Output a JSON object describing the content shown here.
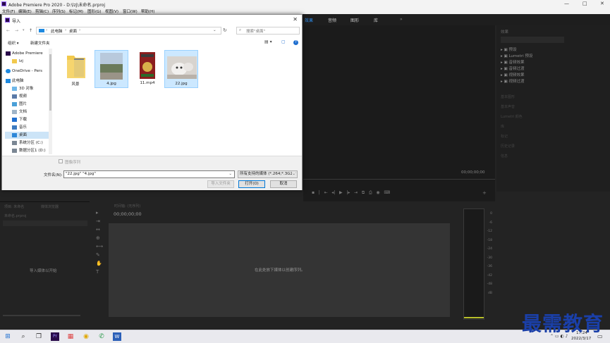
{
  "app": {
    "title": "Adobe Premiere Pro 2020 - D:\\lzj\\未命名.prproj",
    "window_controls": [
      "—",
      "□",
      "✕"
    ],
    "menu": [
      "文件(F)",
      "编辑(E)",
      "剪辑(C)",
      "序列(S)",
      "标记(M)",
      "图形(G)",
      "视图(V)",
      "窗口(W)",
      "帮助(H)"
    ],
    "workspaces": [
      "效果",
      "音频",
      "图形",
      "库"
    ],
    "workspace_active": "效果"
  },
  "effects_panel": {
    "title": "效果",
    "items": [
      "预设",
      "Lumetri 预设",
      "音频效果",
      "音频过渡",
      "视频效果",
      "视频过渡"
    ],
    "sections": [
      "基本图形",
      "基本声音",
      "Lumetri 颜色",
      "库",
      "标记",
      "历史记录",
      "信息"
    ]
  },
  "program_monitor": {
    "timecode": "00;00;00;00"
  },
  "dialog": {
    "title": "导入",
    "breadcrumb": [
      "此电脑",
      "桌面"
    ],
    "search_placeholder": "搜索\"桌面\"",
    "toolbar": {
      "organize": "组织 ▾",
      "new_folder": "新建文件夹"
    },
    "sidebar": [
      {
        "label": "Adobe Premiere",
        "icon": "premiere-icon"
      },
      {
        "label": "lzj",
        "icon": "folder-icon"
      },
      {
        "label": "OneDrive - Pers",
        "icon": "cloud-icon"
      },
      {
        "label": "此电脑",
        "icon": "computer-icon"
      },
      {
        "label": "3D 对象",
        "icon": "cube-icon"
      },
      {
        "label": "视频",
        "icon": "video-icon"
      },
      {
        "label": "图片",
        "icon": "picture-icon"
      },
      {
        "label": "文档",
        "icon": "document-icon"
      },
      {
        "label": "下载",
        "icon": "download-icon"
      },
      {
        "label": "音乐",
        "icon": "music-icon"
      },
      {
        "label": "桌面",
        "icon": "desktop-icon",
        "selected": true
      },
      {
        "label": "系统分区 (C:)",
        "icon": "drive-icon"
      },
      {
        "label": "数据分区1 (D:)",
        "icon": "drive-icon"
      }
    ],
    "files": [
      {
        "name": "风景",
        "type": "folder"
      },
      {
        "name": "4.jpg",
        "type": "image",
        "selected": true
      },
      {
        "name": "11.mp4",
        "type": "video"
      },
      {
        "name": "22.jpg",
        "type": "image",
        "selected": true
      }
    ],
    "image_sequence_label": "图像序列",
    "filename_label": "文件名(N):",
    "filename_value": "\"22.jpg\" \"4.jpg\"",
    "filetype_value": "所有支持的媒体 (*.264;*.3G2;*",
    "btn_import_folder": "导入文件夹",
    "btn_open": "打开(O)",
    "btn_cancel": "取消"
  },
  "project_panel": {
    "tabs": [
      "项目: 未命名",
      "媒体浏览器"
    ],
    "file": "未命名.prproj",
    "hint": "导入媒体以开始"
  },
  "timeline": {
    "tab": "时间轴: (无序列)",
    "timecode": "00;00;00;00",
    "hint": "在此处放下媒体以创建序列。"
  },
  "meter_scale": [
    "0",
    "-6",
    "-12",
    "-18",
    "-24",
    "-30",
    "-36",
    "-42",
    "-48",
    "dB"
  ],
  "taskbar": {
    "time": "17:24",
    "date": "2022/3/17"
  },
  "watermark": "最需教育",
  "colors": {
    "accent": "#2d8ceb",
    "selection": "#cce8ff",
    "dialog_bg": "#ffffff"
  }
}
